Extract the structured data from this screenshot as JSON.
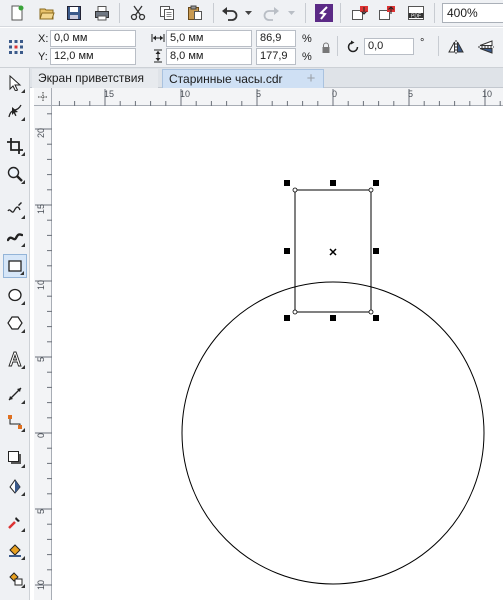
{
  "toolbar": {
    "zoom_value": "400%",
    "buttons": [
      "new-icon",
      "open-icon",
      "save-icon",
      "print-icon",
      "cut-icon",
      "copy-icon",
      "paste-icon",
      "undo-icon",
      "redo-icon",
      "corel-connect-icon",
      "import-icon",
      "export-icon",
      "publish-pdf-icon"
    ]
  },
  "propbar": {
    "x_label": "X:",
    "x_value": "0,0 мм",
    "y_label": "Y:",
    "y_value": "12,0 мм",
    "width_value": "5,0 мм",
    "height_value": "8,0 мм",
    "scale_w": "86,9",
    "scale_h": "177,9",
    "percent": "%",
    "rotation_value": "0,0",
    "degree": "°"
  },
  "tabs": [
    {
      "label": "Экран приветствия",
      "active": false
    },
    {
      "label": "Старинные часы.cdr",
      "active": true
    }
  ],
  "tab_add_label": "+",
  "rulers": {
    "horizontal": [
      "15",
      "10",
      "5",
      "0",
      "5",
      "10"
    ],
    "vertical": [
      "20",
      "15",
      "10",
      "5",
      "0",
      "5",
      "10"
    ]
  },
  "tools": [
    "pick-tool-icon",
    "shape-tool-icon",
    "crop-tool-icon",
    "zoom-tool-icon",
    "freehand-tool-icon",
    "artistic-media-tool-icon",
    "rectangle-tool-icon",
    "ellipse-tool-icon",
    "polygon-tool-icon",
    "text-tool-icon",
    "parallel-dimension-tool-icon",
    "connector-tool-icon",
    "drop-shadow-tool-icon",
    "transparency-tool-icon",
    "color-eyedropper-tool-icon",
    "interactive-fill-tool-icon",
    "smart-fill-tool-icon"
  ],
  "colors": {
    "toolbar_bg": "#eff1f4",
    "accent_logo": "#5b2a86",
    "canvas_bg": "#ffffff",
    "selected_tool_bg": "#d6e6f8"
  }
}
